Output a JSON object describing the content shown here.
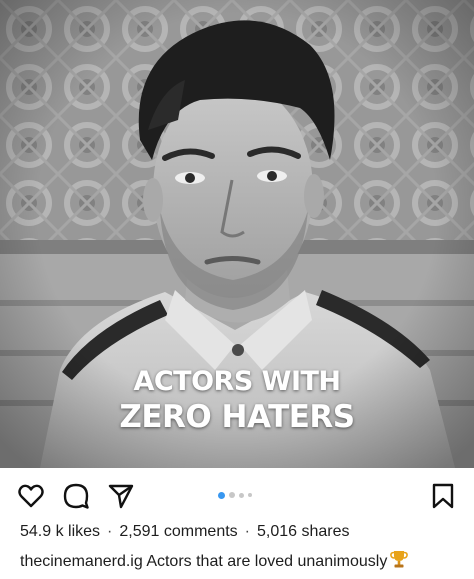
{
  "post": {
    "headline": {
      "line1": "ACTORS WITH",
      "line2": "ZERO HATERS"
    },
    "carousel": {
      "total": 4,
      "active_index": 0,
      "active_color": "#3897f0",
      "inactive_color": "#c7c7c7"
    },
    "stats": {
      "likes": "54.9 k likes",
      "comments": "2,591 comments",
      "shares": "5,016 shares",
      "separator": "·"
    },
    "caption": {
      "username": "thecinemanerd.ig",
      "text": "Actors that are loved unanimously",
      "emoji_icon": "trophy-icon"
    },
    "icons": {
      "like": "heart-icon",
      "comment": "comment-bubble-icon",
      "share": "paper-plane-icon",
      "save": "bookmark-icon"
    }
  }
}
